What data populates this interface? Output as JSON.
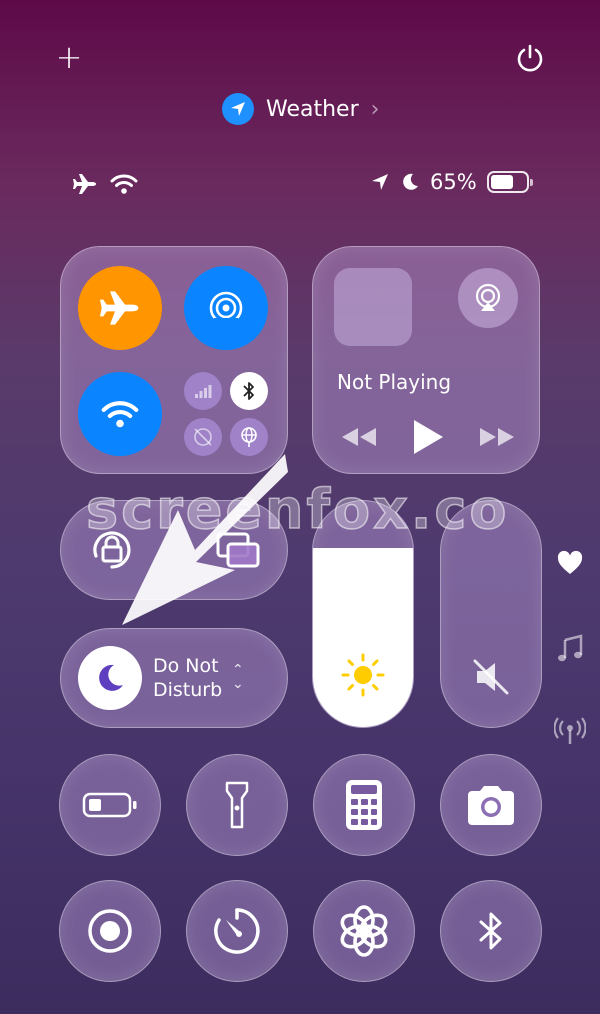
{
  "top": {
    "weather_label": "Weather",
    "weather_chevron": "›",
    "plus_label": "+"
  },
  "status": {
    "battery_percent": "65%",
    "battery_level": 0.65,
    "icons": [
      "airplane-icon",
      "wifi-icon",
      "location-icon",
      "moon-icon",
      "battery-icon"
    ]
  },
  "connectivity": {
    "airplane_mode": true,
    "airdrop": true,
    "wifi": true,
    "cellular": false,
    "bluetooth": true,
    "vpn": false,
    "hotspot": false
  },
  "media": {
    "status": "Not Playing"
  },
  "dnd": {
    "label": "Do Not Disturb",
    "updown": "⌃"
  },
  "sliders": {
    "brightness_level": 0.79,
    "volume_muted": true
  },
  "side_icons": [
    "heart-icon",
    "music-note-icon",
    "antenna-icon"
  ],
  "buttons": [
    "low-power-mode",
    "flashlight",
    "calculator",
    "camera",
    "screen-record",
    "timer",
    "chatgpt",
    "bluetooth"
  ],
  "overlay": {
    "watermark": "screenfox.co"
  },
  "colors": {
    "airplane": "#ff9500",
    "blue": "#0a84ff",
    "sun": "#ffcc00",
    "dnd_moon": "#5e3fbf"
  }
}
